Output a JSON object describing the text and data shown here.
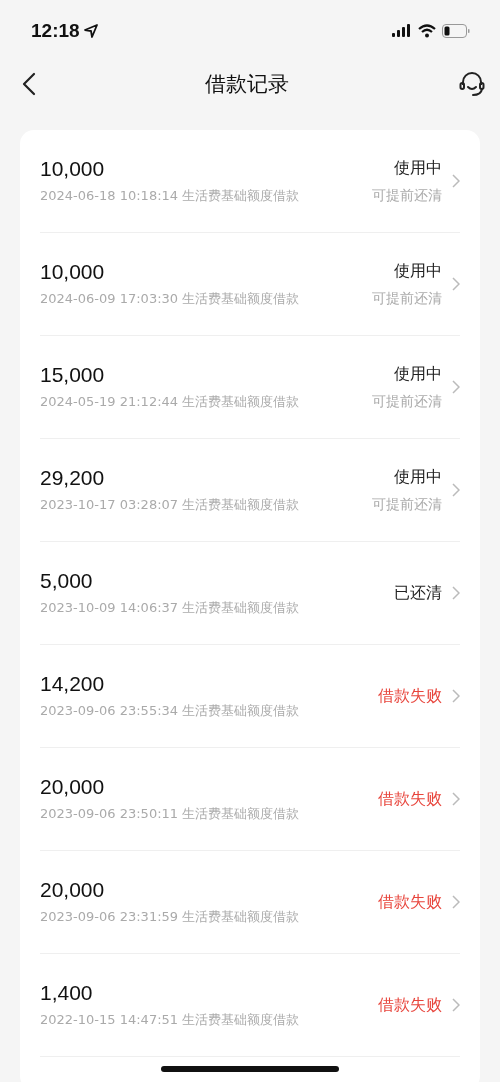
{
  "status_bar": {
    "time": "12:18"
  },
  "nav": {
    "title": "借款记录"
  },
  "records": [
    {
      "amount": "10,000",
      "date": "2024-06-18 10:18:14",
      "desc": "生活费基础额度借款",
      "status": "使用中",
      "kind": "active",
      "note": "可提前还清"
    },
    {
      "amount": "10,000",
      "date": "2024-06-09 17:03:30",
      "desc": "生活费基础额度借款",
      "status": "使用中",
      "kind": "active",
      "note": "可提前还清"
    },
    {
      "amount": "15,000",
      "date": "2024-05-19 21:12:44",
      "desc": "生活费基础额度借款",
      "status": "使用中",
      "kind": "active",
      "note": "可提前还清"
    },
    {
      "amount": "29,200",
      "date": "2023-10-17 03:28:07",
      "desc": "生活费基础额度借款",
      "status": "使用中",
      "kind": "active",
      "note": "可提前还清"
    },
    {
      "amount": "5,000",
      "date": "2023-10-09 14:06:37",
      "desc": "生活费基础额度借款",
      "status": "已还清",
      "kind": "repaid"
    },
    {
      "amount": "14,200",
      "date": "2023-09-06 23:55:34",
      "desc": "生活费基础额度借款",
      "status": "借款失败",
      "kind": "failed"
    },
    {
      "amount": "20,000",
      "date": "2023-09-06 23:50:11",
      "desc": "生活费基础额度借款",
      "status": "借款失败",
      "kind": "failed"
    },
    {
      "amount": "20,000",
      "date": "2023-09-06 23:31:59",
      "desc": "生活费基础额度借款",
      "status": "借款失败",
      "kind": "failed"
    },
    {
      "amount": "1,400",
      "date": "2022-10-15 14:47:51",
      "desc": "生活费基础额度借款",
      "status": "借款失败",
      "kind": "failed"
    }
  ]
}
